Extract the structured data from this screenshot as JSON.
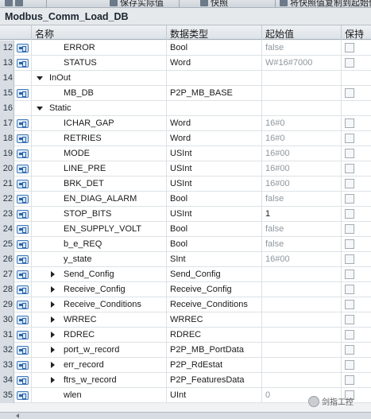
{
  "toolbar": {
    "items": [
      "保存实际值",
      "快照",
      "将快照值复制到起始值"
    ]
  },
  "block_title": "Modbus_Comm_Load_DB",
  "columns": {
    "name": "名称",
    "datatype": "数据类型",
    "start": "起始值",
    "retain": "保持"
  },
  "rows": [
    {
      "num": "12",
      "kind": "var",
      "indent": 2,
      "name": "ERROR",
      "type": "Bool",
      "start": "false",
      "start_dim": true
    },
    {
      "num": "13",
      "kind": "var",
      "indent": 2,
      "name": "STATUS",
      "type": "Word",
      "start": "W#16#7000",
      "start_dim": true
    },
    {
      "num": "14",
      "kind": "section",
      "indent": 0,
      "name": "InOut",
      "type": "",
      "start": ""
    },
    {
      "num": "15",
      "kind": "var",
      "indent": 2,
      "name": "MB_DB",
      "type": "P2P_MB_BASE",
      "start": ""
    },
    {
      "num": "16",
      "kind": "section",
      "indent": 0,
      "name": "Static",
      "type": "",
      "start": ""
    },
    {
      "num": "17",
      "kind": "var",
      "indent": 2,
      "name": "ICHAR_GAP",
      "type": "Word",
      "start": "16#0",
      "start_dim": true
    },
    {
      "num": "18",
      "kind": "var",
      "indent": 2,
      "name": "RETRIES",
      "type": "Word",
      "start": "16#0",
      "start_dim": true
    },
    {
      "num": "19",
      "kind": "var",
      "indent": 2,
      "name": "MODE",
      "type": "USInt",
      "start": "16#00",
      "start_dim": true
    },
    {
      "num": "20",
      "kind": "var",
      "indent": 2,
      "name": "LINE_PRE",
      "type": "USInt",
      "start": "16#00",
      "start_dim": true
    },
    {
      "num": "21",
      "kind": "var",
      "indent": 2,
      "name": "BRK_DET",
      "type": "USInt",
      "start": "16#00",
      "start_dim": true
    },
    {
      "num": "22",
      "kind": "var",
      "indent": 2,
      "name": "EN_DIAG_ALARM",
      "type": "Bool",
      "start": "false",
      "start_dim": true
    },
    {
      "num": "23",
      "kind": "var",
      "indent": 2,
      "name": "STOP_BITS",
      "type": "USInt",
      "start": "1",
      "start_dim": false
    },
    {
      "num": "24",
      "kind": "var",
      "indent": 2,
      "name": "EN_SUPPLY_VOLT",
      "type": "Bool",
      "start": "false",
      "start_dim": true
    },
    {
      "num": "25",
      "kind": "var",
      "indent": 2,
      "name": "b_e_REQ",
      "type": "Bool",
      "start": "false",
      "start_dim": true
    },
    {
      "num": "26",
      "kind": "var",
      "indent": 2,
      "name": "y_state",
      "type": "SInt",
      "start": "16#00",
      "start_dim": true
    },
    {
      "num": "27",
      "kind": "struct",
      "indent": 2,
      "name": "Send_Config",
      "type": "Send_Config",
      "start": ""
    },
    {
      "num": "28",
      "kind": "struct",
      "indent": 2,
      "name": "Receive_Config",
      "type": "Receive_Config",
      "start": ""
    },
    {
      "num": "29",
      "kind": "struct",
      "indent": 2,
      "name": "Receive_Conditions",
      "type": "Receive_Conditions",
      "start": ""
    },
    {
      "num": "30",
      "kind": "struct",
      "indent": 2,
      "name": "WRREC",
      "type": "WRREC",
      "start": ""
    },
    {
      "num": "31",
      "kind": "struct",
      "indent": 2,
      "name": "RDREC",
      "type": "RDREC",
      "start": ""
    },
    {
      "num": "32",
      "kind": "struct",
      "indent": 2,
      "name": "port_w_record",
      "type": "P2P_MB_PortData",
      "start": ""
    },
    {
      "num": "33",
      "kind": "struct",
      "indent": 2,
      "name": "err_record",
      "type": "P2P_RdEstat",
      "start": ""
    },
    {
      "num": "34",
      "kind": "struct",
      "indent": 2,
      "name": "ftrs_w_record",
      "type": "P2P_FeaturesData",
      "start": ""
    },
    {
      "num": "35",
      "kind": "var",
      "indent": 2,
      "name": "wlen",
      "type": "UInt",
      "start": "0",
      "start_dim": true
    }
  ],
  "watermark": "剑指工控",
  "colors": {
    "icon_blue": "#2f62b8",
    "dim_text": "#8f979e",
    "rownum_bg": "#d7dde3"
  }
}
